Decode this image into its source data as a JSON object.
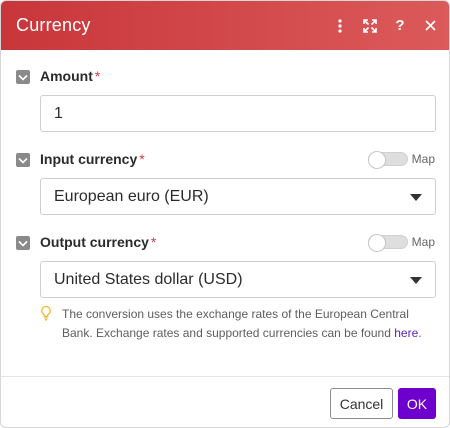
{
  "dialog": {
    "title": "Currency",
    "header_icons": [
      "more-vertical-icon",
      "expand-icon",
      "help-icon",
      "close-icon"
    ],
    "help_glyph": "?"
  },
  "fields": {
    "amount": {
      "label": "Amount",
      "required_mark": "*",
      "value": "1"
    },
    "input_currency": {
      "label": "Input currency",
      "required_mark": "*",
      "map_label": "Map",
      "selected": "European euro (EUR)"
    },
    "output_currency": {
      "label": "Output currency",
      "required_mark": "*",
      "map_label": "Map",
      "selected": "United States dollar (USD)"
    }
  },
  "hint": {
    "text": "The conversion uses the exchange rates of the European Central Bank. Exchange rates and supported currencies can be found ",
    "link_text": "here",
    "suffix": "."
  },
  "footer": {
    "cancel_label": "Cancel",
    "ok_label": "OK"
  },
  "colors": {
    "header_start": "#c8363a",
    "header_end": "#dc5a5b",
    "ok_button": "#6d00cc",
    "link": "#5b1fb5",
    "required": "#d63b4a"
  }
}
